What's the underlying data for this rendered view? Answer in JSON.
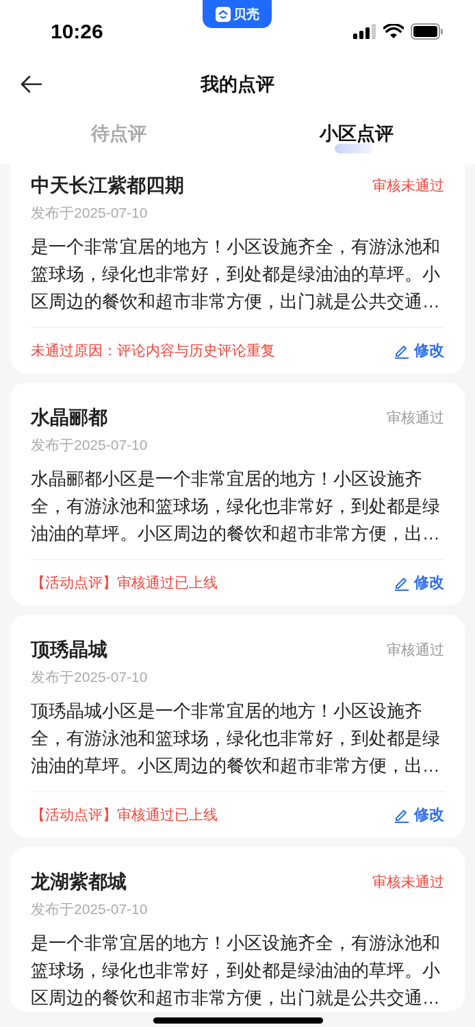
{
  "status_bar": {
    "time": "10:26",
    "app_badge": "贝壳"
  },
  "nav": {
    "title": "我的点评"
  },
  "tabs": [
    {
      "label": "待点评",
      "selected": false
    },
    {
      "label": "小区点评",
      "selected": true
    }
  ],
  "reviews": [
    {
      "title": "中天长江紫都四期",
      "status": "审核未通过",
      "rejected": true,
      "date": "发布于2025-07-10",
      "text": "是一个非常宜居的地方！小区设施齐全，有游泳池和篮球场，绿化也非常好，到处都是绿油油的草坪。小区周边的餐饮和超市非常方便，出门就是公共交通…",
      "note": "未通过原因：评论内容与历史评论重复",
      "action": "修改"
    },
    {
      "title": "水晶郦都",
      "status": "审核通过",
      "rejected": false,
      "date": "发布于2025-07-10",
      "text": "水晶郦都小区是一个非常宜居的地方！小区设施齐全，有游泳池和篮球场，绿化也非常好，到处都是绿油油的草坪。小区周边的餐饮和超市非常方便，出…",
      "note": "【活动点评】审核通过已上线",
      "action": "修改"
    },
    {
      "title": "顶琇晶城",
      "status": "审核通过",
      "rejected": false,
      "date": "发布于2025-07-10",
      "text": "顶琇晶城小区是一个非常宜居的地方！小区设施齐全，有游泳池和篮球场，绿化也非常好，到处都是绿油油的草坪。小区周边的餐饮和超市非常方便，出…",
      "note": "【活动点评】审核通过已上线",
      "action": "修改"
    },
    {
      "title": "龙湖紫都城",
      "status": "审核未通过",
      "rejected": true,
      "date": "发布于2025-07-10",
      "text": "是一个非常宜居的地方！小区设施齐全，有游泳池和篮球场，绿化也非常好，到处都是绿油油的草坪。小区周边的餐饮和超市非常方便，出门就是公共交通…"
    }
  ]
}
